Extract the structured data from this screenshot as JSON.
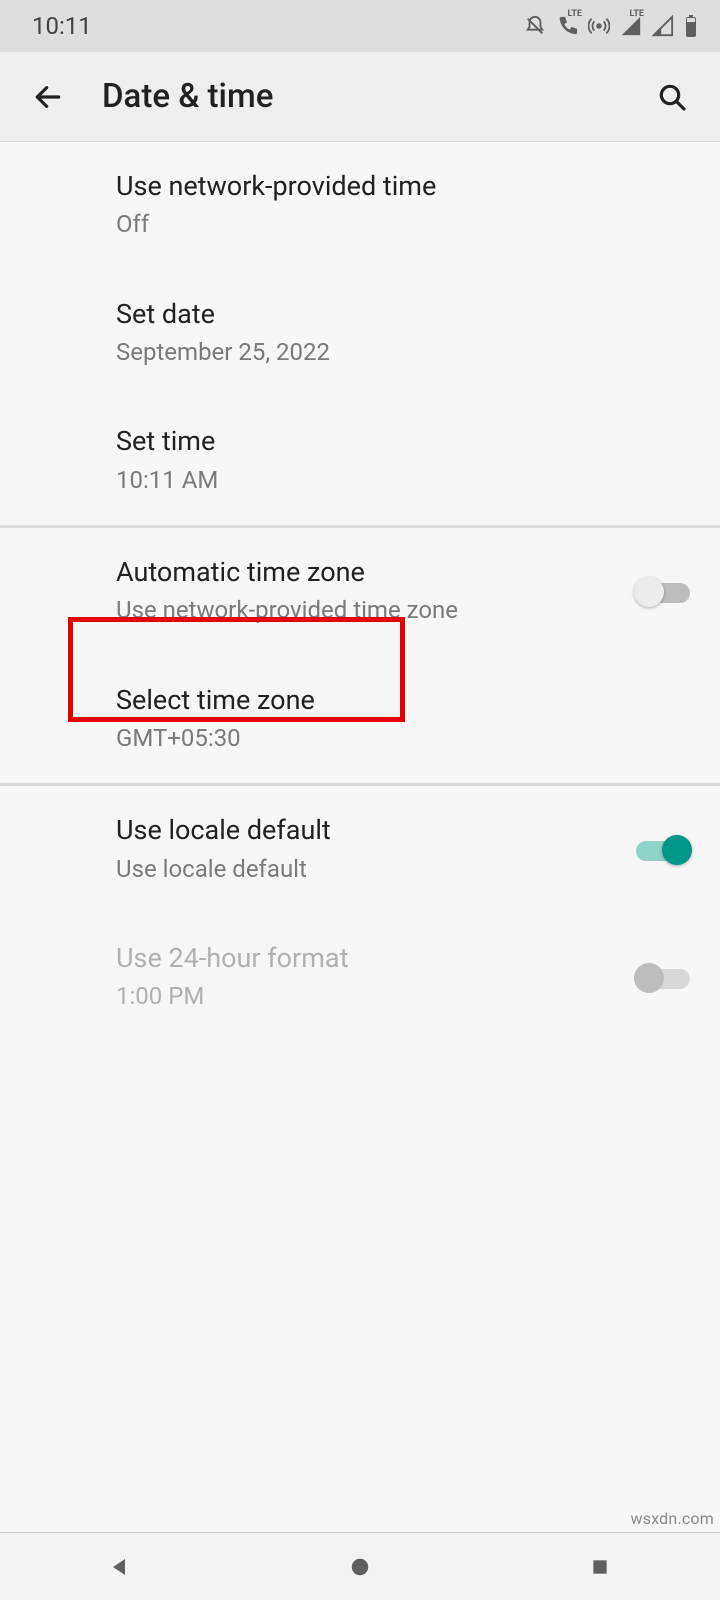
{
  "status": {
    "time": "10:11"
  },
  "header": {
    "title": "Date & time"
  },
  "items": {
    "network_time": {
      "title": "Use network-provided time",
      "sub": "Off"
    },
    "set_date": {
      "title": "Set date",
      "sub": "September 25, 2022"
    },
    "set_time": {
      "title": "Set time",
      "sub": "10:11 AM"
    },
    "auto_tz": {
      "title": "Automatic time zone",
      "sub": "Use network-provided time zone",
      "on": false
    },
    "select_tz": {
      "title": "Select time zone",
      "sub": "GMT+05:30"
    },
    "locale": {
      "title": "Use locale default",
      "sub": "Use locale default",
      "on": true
    },
    "h24": {
      "title": "Use 24-hour format",
      "sub": "1:00 PM",
      "on": false,
      "disabled": true
    }
  },
  "watermark": "wsxdn.com"
}
